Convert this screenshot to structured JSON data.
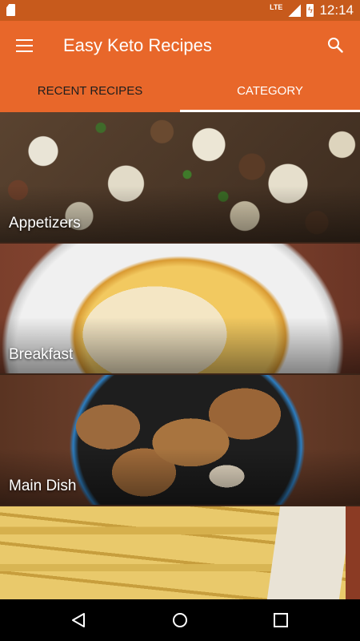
{
  "status_bar": {
    "network_label": "LTE",
    "time": "12:14",
    "icons": [
      "sd-card-icon",
      "signal-icon",
      "battery-charging-icon"
    ]
  },
  "app_bar": {
    "title": "Easy Keto Recipes",
    "menu_icon": "hamburger-menu-icon",
    "search_icon": "search-icon"
  },
  "tabs": [
    {
      "label": "RECENT RECIPES",
      "selected": false
    },
    {
      "label": "CATEGORY",
      "selected": true
    }
  ],
  "categories": [
    {
      "label": "Appetizers"
    },
    {
      "label": "Breakfast"
    },
    {
      "label": "Main Dish"
    },
    {
      "label": ""
    }
  ],
  "nav_bar": {
    "icons": [
      "back-icon",
      "home-icon",
      "recents-icon"
    ]
  },
  "colors": {
    "primary": "#e8672a",
    "status_bar": "#c75a1c",
    "nav_bar": "#000000",
    "tab_indicator": "#ffffff"
  }
}
